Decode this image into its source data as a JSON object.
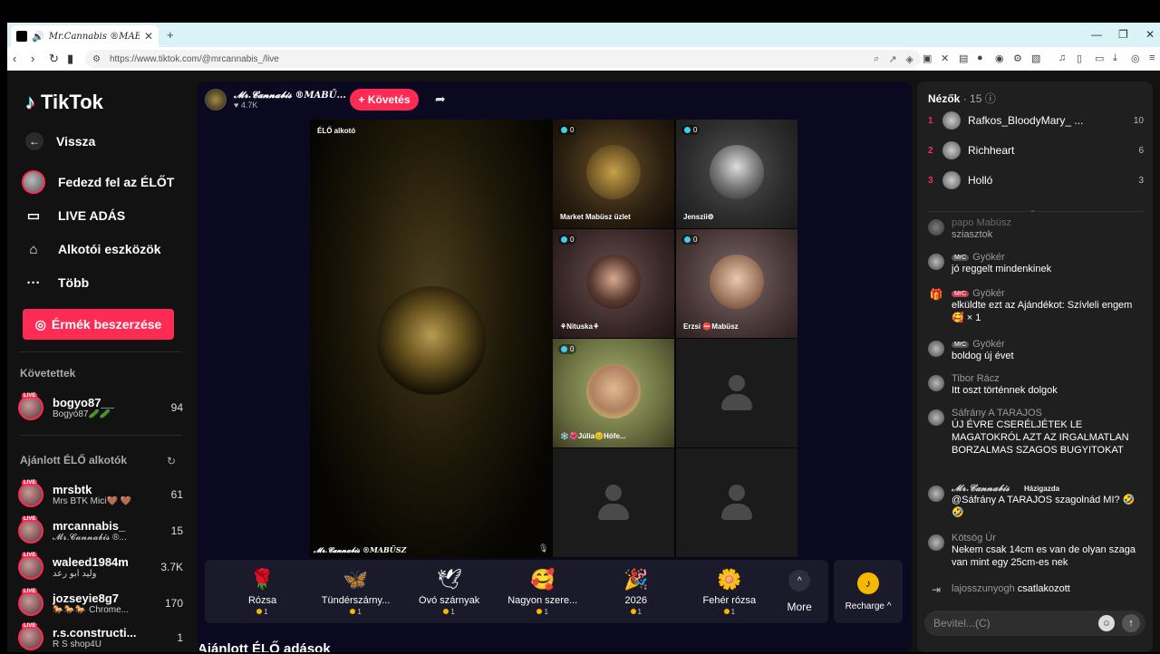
{
  "browser": {
    "tab_title": "Mr.Cannabis ®MABÜSZ",
    "url": "https://www.tiktok.com/@mrcannabis_/live"
  },
  "sidebar": {
    "logo": "TikTok",
    "back": "Vissza",
    "nav": [
      "Fedezd fel az ÉLŐT",
      "LIVE ADÁS",
      "Alkotói eszközök",
      "Több"
    ],
    "coins_button": "Érmék beszerzése",
    "following_title": "Követettek",
    "following": [
      {
        "name": "bogyo87__",
        "sub": "Bogyó87🥒🥒",
        "count": "94"
      }
    ],
    "recommended_title": "Ajánlott ÉLŐ alkotók",
    "recommended": [
      {
        "name": "mrsbtk",
        "sub": "Mrs BTK Mici🤎 🤎",
        "count": "61"
      },
      {
        "name": "mrcannabis_",
        "sub": "𝓜𝓻.𝓒𝓪𝓷𝓷𝓪𝓫𝓲𝓼 ®...",
        "count": "15"
      },
      {
        "name": "waleed1984m",
        "sub": "وليد ابو رعد",
        "count": "3.7K"
      },
      {
        "name": "jozseyie8g7",
        "sub": "🐎🐎🐎 Chrome...",
        "count": "170"
      },
      {
        "name": "r.s.constructi...",
        "sub": "R S shop4U",
        "count": "1"
      }
    ]
  },
  "stream": {
    "host_name": "𝓜𝓻.𝓒𝓪𝓷𝓷𝓪𝓫𝓲𝓼 ®MABŰ...",
    "likes": "♥ 4.7K",
    "follow_label": "+ Követés",
    "live_tag": "ÉLŐ alkotó",
    "main_label": "𝓜𝓻.𝓒𝓪𝓷𝓷𝓪𝓫𝓲𝓼 ®MABÜSZ",
    "guests": [
      {
        "badge": "0",
        "label": "Market Mabüsz üzlet"
      },
      {
        "badge": "0",
        "label": "Jenszii⚙"
      },
      {
        "badge": "0",
        "label": "⚘Nituska⚘"
      },
      {
        "badge": "0",
        "label": "Erzsi ⛔Mabüsz"
      },
      {
        "badge": "0",
        "label": "❄️🌺Júlia😊Hófe..."
      }
    ],
    "gifts": [
      {
        "icon": "🌹",
        "name": "Rózsa",
        "price": "1"
      },
      {
        "icon": "🦋",
        "name": "Tündérszárny...",
        "price": "1"
      },
      {
        "icon": "🕊",
        "name": "Óvó szárnyak",
        "price": "1"
      },
      {
        "icon": "🥰",
        "name": "Nagyon szere...",
        "price": "1"
      },
      {
        "icon": "🎉",
        "name": "2026",
        "price": "1"
      },
      {
        "icon": "🌼",
        "name": "Fehér rózsa",
        "price": "1"
      }
    ],
    "more_label": "More",
    "recharge_label": "Recharge ^",
    "recommended_title": "Ajánlott ÉLŐ adások"
  },
  "viewers": {
    "title": "Nézők",
    "count": "· 15",
    "list": [
      {
        "rank": "1",
        "name": "Rafkos_BloodyMary_ ...",
        "score": "10"
      },
      {
        "rank": "2",
        "name": "Richheart",
        "score": "6"
      },
      {
        "rank": "3",
        "name": "Holló",
        "score": "3"
      }
    ]
  },
  "chat": {
    "messages": [
      {
        "user": "papo Mabüsz",
        "text": "sziasztok",
        "badge": ""
      },
      {
        "user": "Gyökér",
        "text": "jó reggelt mindenkinek",
        "badge": "MrC"
      },
      {
        "user": "Gyökér",
        "text": "elküldte ezt az Ajándékot: Szívleli engem 🥰 × 1",
        "badge": "MrC"
      },
      {
        "user": "Gyökér",
        "text": "boldog új évet",
        "badge": "MrC"
      },
      {
        "user": "Tibor Rácz",
        "text": "Itt oszt történnek dolgok",
        "badge": ""
      },
      {
        "user": "Sáfrány A TARAJOS",
        "text": "ÚJ ÉVRE CSERÉLJÉTEK LE MAGATOKRÓL AZT AZ IRGALMATLAN BORZALMAS SZAGOS BUGYITOKAT",
        "badge": ""
      },
      {
        "user": "𝓜𝓻.𝓒𝓪𝓷𝓷𝓪𝓫𝓲𝓼",
        "host_tag": "Házigazda",
        "text": "@Sáfrány A TARAJOS szagolnád MI? 🤣🤣",
        "badge": ""
      },
      {
        "user": "Kötsög Úr",
        "text": "Nekem csak 14cm es van de olyan szaga van mint egy 25cm-es nek",
        "badge": ""
      }
    ],
    "join_user": "lajosszunyogh",
    "join_text": "csatlakozott",
    "input_placeholder": "Bevitel...(C)"
  }
}
